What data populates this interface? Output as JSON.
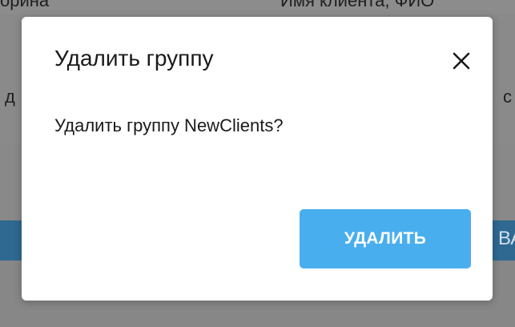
{
  "background": {
    "top_left_fragment": "орина",
    "top_right_fragment": "Имя клиента, ФИО",
    "mid_left_fragment": "д",
    "mid_right_fragment": "с",
    "button_fragment": "ВА"
  },
  "dialog": {
    "title": "Удалить группу",
    "message": "Удалить группу NewClients?",
    "delete_label": "УДАЛИТЬ",
    "close_icon": "close-icon",
    "accent_color": "#49aeee"
  }
}
